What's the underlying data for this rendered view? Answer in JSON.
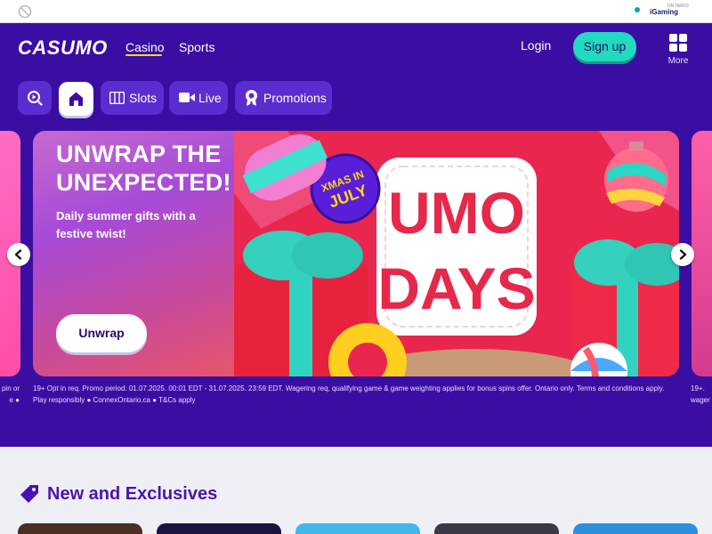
{
  "utility": {
    "badge_prefix": "ONTARIO",
    "badge_name": "iGaming"
  },
  "header": {
    "logo": "CASUMO",
    "nav": [
      {
        "label": "Casino",
        "active": true
      },
      {
        "label": "Sports",
        "active": false
      }
    ],
    "login_label": "Login",
    "signup_label": "Sign up",
    "more_label": "More"
  },
  "categories": [
    {
      "label": "",
      "icon": "search-play-icon"
    },
    {
      "label": "",
      "icon": "home-icon",
      "active": true
    },
    {
      "label": "Slots",
      "icon": "slots-icon"
    },
    {
      "label": "Live",
      "icon": "camera-icon"
    },
    {
      "label": "Promotions",
      "icon": "badge-icon"
    }
  ],
  "hero": {
    "title": "UNWRAP THE UNEXPECTED!",
    "subtitle": "Daily summer gifts with a festive twist!",
    "cta_label": "Unwrap",
    "badge_text": "XMAS IN JULY",
    "art_text_line1": "UMO",
    "art_text_line2": "DAYS",
    "terms": "19+ Opt in req. Promo period: 01.07.2025. 00:01 EDT - 31.07.2025. 23:59 EDT. Wagering req, qualifying game & game weighting applies for bonus spins offer. Ontario only. Terms and conditions apply. Play responsibly ● ConnexOntario.ca ● T&Cs apply",
    "terms_left_fragment": "pin or\ne ●",
    "terms_right_fragment": "19+.\nwager"
  },
  "section": {
    "title": "New and Exclusives",
    "icon": "tag-icon"
  },
  "colors": {
    "brand_purple": "#3a0ea3",
    "accent_teal": "#23d9c0",
    "accent_yellow": "#ffd71a",
    "banner_red": "#e6284a"
  }
}
